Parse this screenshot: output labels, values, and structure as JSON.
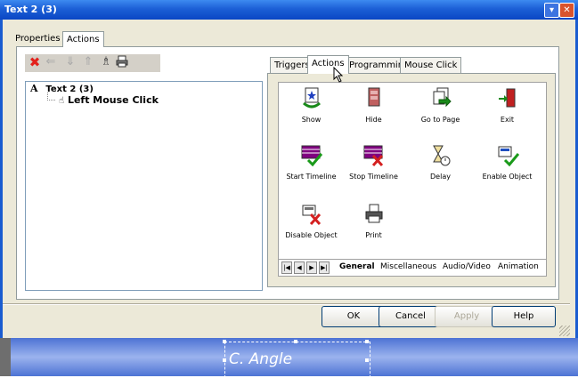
{
  "window": {
    "title": "Text 2 (3)"
  },
  "title_buttons": {
    "minimize": "▾",
    "close": "✕"
  },
  "main_tabs": [
    {
      "label": "Properties",
      "selected": false
    },
    {
      "label": "Actions",
      "selected": true
    }
  ],
  "toolbar": {
    "icons": [
      "delete-icon",
      "arrow-left-icon",
      "arrow-down-icon",
      "arrow-up-icon",
      "person-icon",
      "print-icon"
    ]
  },
  "tree": {
    "root_prefix": "A",
    "root_label": "Text 2 (3)",
    "child_label": "Left Mouse Click"
  },
  "right_tabs": [
    {
      "label": "Triggers",
      "selected": false
    },
    {
      "label": "Actions",
      "selected": true
    },
    {
      "label": "Programming",
      "selected": false
    },
    {
      "label": "Mouse Click",
      "selected": false
    }
  ],
  "actions": [
    {
      "label": "Show",
      "icon": "show-icon"
    },
    {
      "label": "Hide",
      "icon": "hide-icon"
    },
    {
      "label": "Go to Page",
      "icon": "go-to-page-icon"
    },
    {
      "label": "Exit",
      "icon": "exit-icon"
    },
    {
      "label": "Start Timeline",
      "icon": "start-timeline-icon"
    },
    {
      "label": "Stop Timeline",
      "icon": "stop-timeline-icon"
    },
    {
      "label": "Delay",
      "icon": "hourglass-icon"
    },
    {
      "label": "Enable Object",
      "icon": "enable-object-icon"
    },
    {
      "label": "Disable Object",
      "icon": "disable-object-icon"
    },
    {
      "label": "Print",
      "icon": "print-icon"
    }
  ],
  "category_tabs": [
    {
      "label": "General",
      "selected": true
    },
    {
      "label": "Miscellaneous",
      "selected": false
    },
    {
      "label": "Audio/Video",
      "selected": false
    },
    {
      "label": "Animation",
      "selected": false
    }
  ],
  "nav_arrows": [
    "|◀",
    "◀",
    "▶",
    "▶|"
  ],
  "buttons": {
    "ok": "OK",
    "cancel": "Cancel",
    "apply": "Apply",
    "help": "Help"
  },
  "canvas": {
    "text": "C. Angle"
  },
  "colors": {
    "titlebar": "#0a46c4",
    "dialog_bg": "#ece9d8",
    "close_button": "#d9532c"
  }
}
